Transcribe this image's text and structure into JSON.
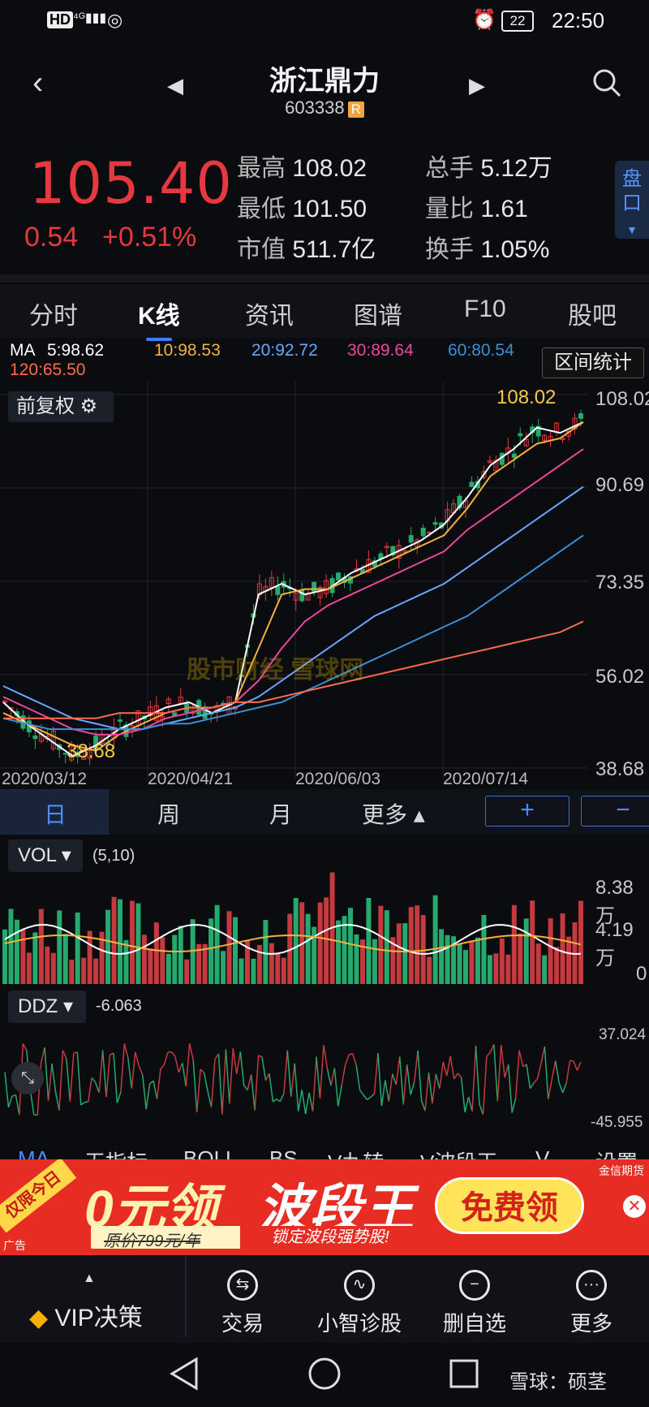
{
  "status": {
    "left_icons": "HD 4G",
    "signal": "signal-icon",
    "hotspot": "hotspot-icon",
    "alarm": "alarm-icon",
    "battery": "22",
    "time": "22:50"
  },
  "header": {
    "name": "浙江鼎力",
    "code": "603338",
    "badge": "R"
  },
  "quote": {
    "price": "105.40",
    "change": "0.54",
    "change_pct": "+0.51%",
    "high_label": "最高",
    "high": "108.02",
    "low_label": "最低",
    "low": "101.50",
    "mcap_label": "市值",
    "mcap": "511.7亿",
    "vol_label": "总手",
    "vol": "5.12万",
    "ratio_label": "量比",
    "ratio": "1.61",
    "turn_label": "换手",
    "turn": "1.05%",
    "pankou": "盘口"
  },
  "tabs": [
    "分时",
    "K线",
    "资讯",
    "图谱",
    "F10",
    "股吧"
  ],
  "ma": {
    "label": "MA",
    "ma5": "5:98.62",
    "ma10": "10:98.53",
    "ma20": "20:92.72",
    "ma30": "30:89.64",
    "ma60": "60:80.54",
    "ma120": "120:65.50"
  },
  "range_button": "区间统计",
  "fuquan_button": "前复权",
  "watermark": "股市财经 雪球网",
  "chart_data": {
    "type": "candlestick",
    "y_axis": [
      "108.02",
      "90.69",
      "73.35",
      "56.02",
      "38.68"
    ],
    "x_axis": [
      "2020/03/12",
      "2020/04/21",
      "2020/06/03",
      "2020/07/14"
    ],
    "high_label": "108.02",
    "low_label": "38.68",
    "series": [
      {
        "name": "5",
        "color": "#ffffff",
        "values": [
          50,
          46,
          43,
          40,
          42,
          45,
          47,
          49,
          50,
          48,
          50,
          70,
          72,
          70,
          71,
          74,
          76,
          78,
          80,
          83,
          88,
          94,
          97,
          101,
          100,
          102
        ]
      },
      {
        "name": "10",
        "color": "#f5b041",
        "values": [
          48,
          46,
          44,
          42,
          41,
          44,
          46,
          48,
          49,
          49,
          50,
          60,
          70,
          71,
          71,
          73,
          75,
          77,
          79,
          81,
          86,
          92,
          95,
          98,
          99,
          102
        ]
      },
      {
        "name": "20",
        "color": "#e8489d",
        "values": [
          51,
          49,
          47,
          45,
          44,
          44,
          45,
          47,
          48,
          49,
          50,
          54,
          60,
          65,
          68,
          70,
          72,
          74,
          76,
          78,
          82,
          85,
          88,
          91,
          94,
          97
        ]
      },
      {
        "name": "30",
        "color": "#6aa5ff",
        "values": [
          53,
          51,
          49,
          47,
          46,
          45,
          45,
          46,
          47,
          48,
          49,
          51,
          54,
          57,
          60,
          63,
          66,
          68,
          70,
          72,
          75,
          78,
          81,
          84,
          87,
          90
        ]
      },
      {
        "name": "60",
        "color": "#3a8fd6",
        "values": [
          47,
          46,
          45,
          45,
          45,
          45,
          45,
          46,
          46,
          47,
          48,
          49,
          50,
          52,
          54,
          56,
          58,
          60,
          62,
          64,
          66,
          69,
          72,
          75,
          78,
          81
        ]
      },
      {
        "name": "120",
        "color": "#ff6b4a",
        "values": [
          47,
          47,
          47,
          47,
          47,
          48,
          48,
          48,
          49,
          49,
          50,
          50,
          51,
          52,
          53,
          54,
          55,
          56,
          57,
          58,
          59,
          60,
          61,
          62,
          63,
          65
        ]
      }
    ]
  },
  "period": {
    "day": "日",
    "week": "周",
    "month": "月",
    "more": "更多",
    "plus": "+",
    "minus": "−"
  },
  "volume": {
    "label": "VOL",
    "params": "(5,10)",
    "max": "8.38万",
    "mid": "4.19万",
    "zero": "0"
  },
  "ddz": {
    "label": "DDZ",
    "value": "-6.063",
    "max": "37.024",
    "min": "-45.955"
  },
  "indicators": [
    "MA",
    "无指标",
    "BOLL",
    "BS",
    "V九转",
    "V波段王",
    "V",
    "设置"
  ],
  "ad": {
    "tag": "仅限今日",
    "headline_a": "0元领",
    "headline_b": "波段王",
    "orig": "原价799元/年",
    "slogan": "锁定波段强势股!",
    "cta": "免费领",
    "brand": "金信期货",
    "small": "广告"
  },
  "bottom_nav": [
    {
      "label": "VIP决策",
      "icon": "diamond-icon"
    },
    {
      "label": "交易",
      "icon": "exchange-icon"
    },
    {
      "label": "小智诊股",
      "icon": "pulse-icon"
    },
    {
      "label": "删自选",
      "icon": "minus-circle-icon"
    },
    {
      "label": "更多",
      "icon": "more-icon"
    }
  ],
  "system_nav": {
    "back": "back-icon",
    "home": "home-icon",
    "recent": "recent-icon",
    "credit": "雪球：硕茎"
  }
}
